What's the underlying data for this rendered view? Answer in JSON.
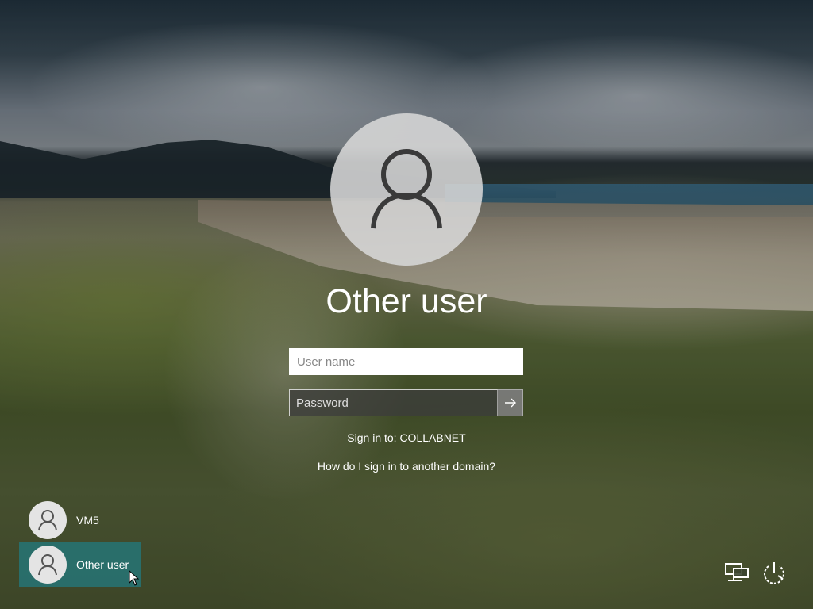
{
  "login": {
    "title": "Other user",
    "username_placeholder": "User name",
    "password_placeholder": "Password",
    "sign_in_to": "Sign in to: COLLABNET",
    "domain_help_link": "How do I sign in to another domain?"
  },
  "accounts": [
    {
      "name": "VM5",
      "selected": false
    },
    {
      "name": "Other user",
      "selected": true
    }
  ],
  "icons": {
    "avatar": "user-icon",
    "submit": "arrow-right-icon",
    "network": "network-icon",
    "power": "power-icon"
  },
  "colors": {
    "selected_account_bg": "#267476"
  }
}
